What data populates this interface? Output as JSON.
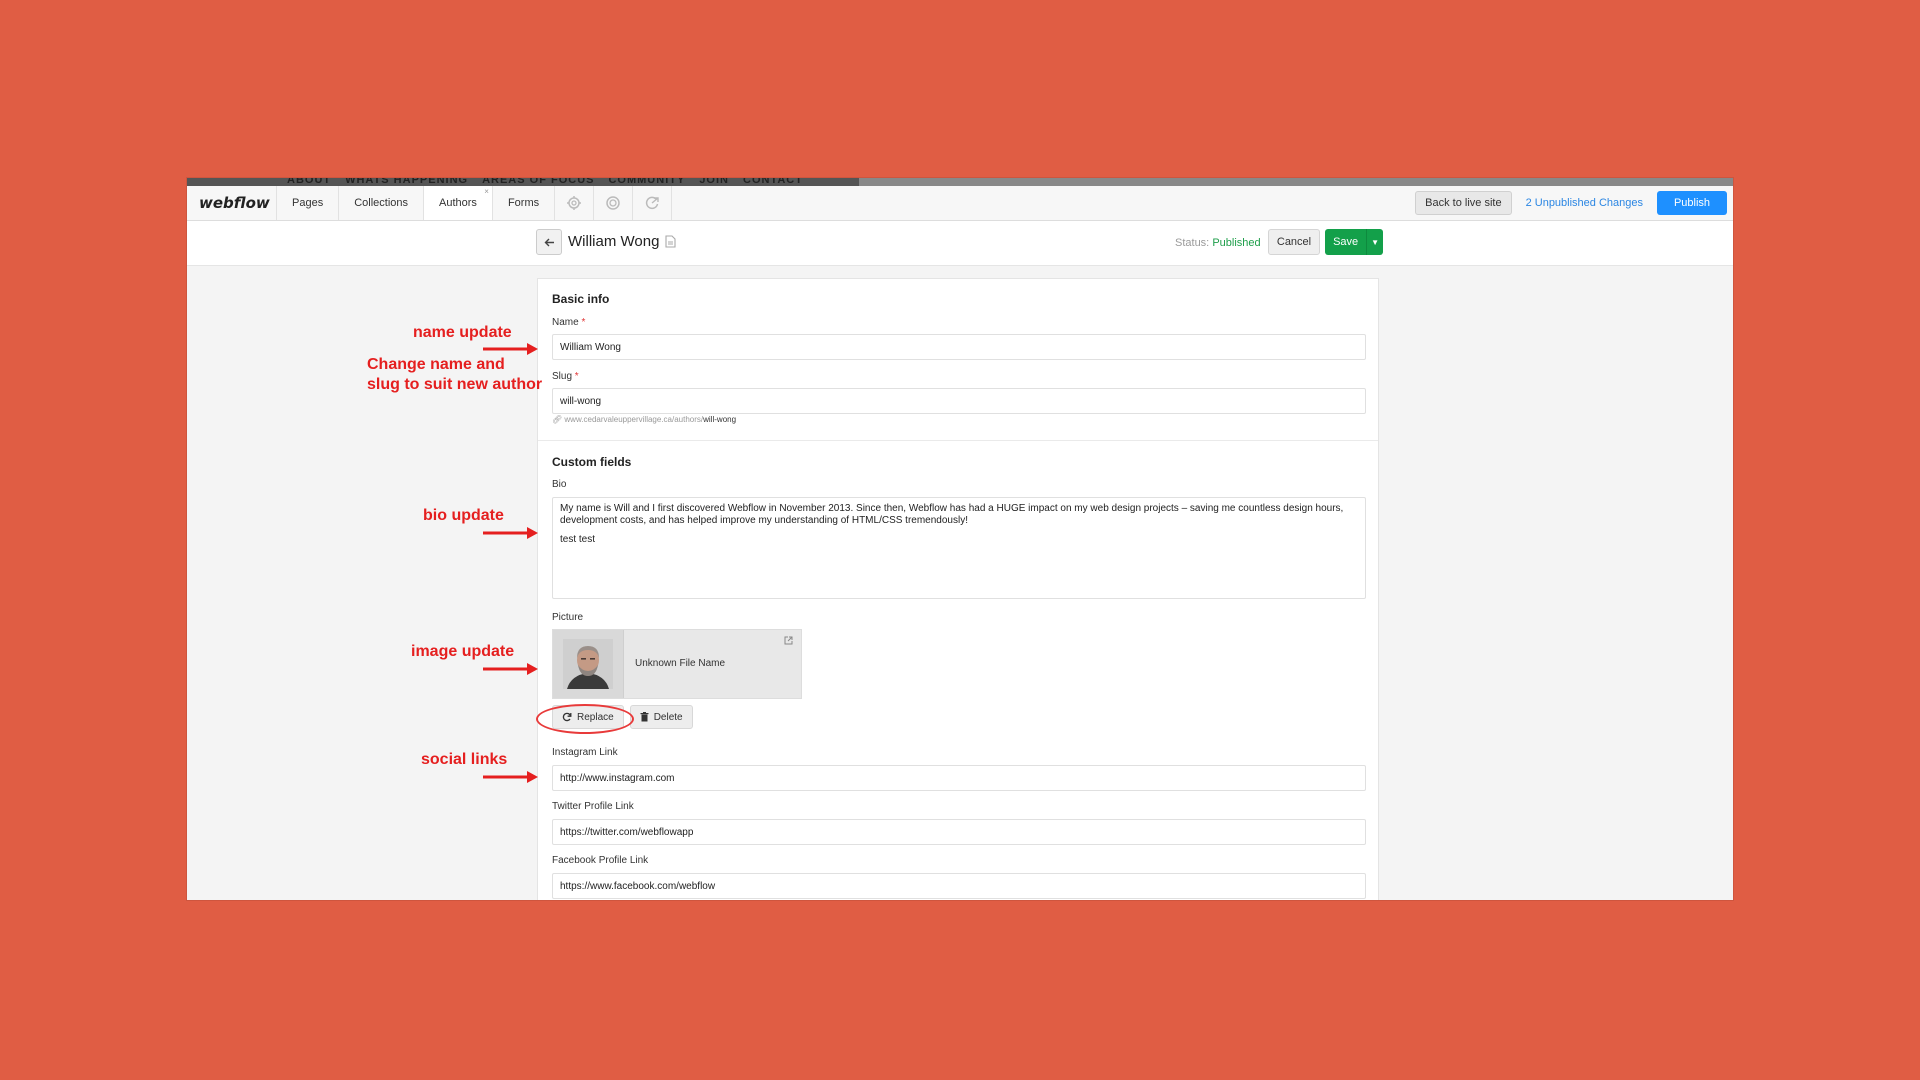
{
  "site_nav": [
    "ABOUT",
    "WHATS HAPPENING",
    "AREAS OF FOCUS",
    "COMMUNITY",
    "JOIN",
    "CONTACT"
  ],
  "topbar": {
    "logo": "webflow",
    "tabs": [
      "Pages",
      "Collections",
      "Authors",
      "Forms"
    ],
    "active_tab_close": "×",
    "icons": [
      "gear-icon",
      "settings-icon",
      "export-icon"
    ],
    "back_to_live": "Back to live site",
    "unpublished": "2 Unpublished Changes",
    "publish": "Publish"
  },
  "header": {
    "title": "William Wong",
    "status_label": "Status:",
    "status_value": "Published",
    "cancel": "Cancel",
    "save": "Save"
  },
  "basic": {
    "title": "Basic info",
    "name_label": "Name",
    "required": "*",
    "name_value": "William Wong",
    "slug_label": "Slug",
    "slug_value": "will-wong",
    "slug_url_base": "www.cedarvaleuppervillage.ca/authors/",
    "slug_url_slug": "will-wong"
  },
  "custom": {
    "title": "Custom fields",
    "bio_label": "Bio",
    "bio_p1": "My name is Will and I first discovered Webflow in November 2013. Since then, Webflow has had a HUGE impact on my web design projects – saving me countless design hours, development costs, and has helped improve my understanding of HTML/CSS tremendously!",
    "bio_p2": "test test",
    "picture_label": "Picture",
    "file_name": "Unknown File Name",
    "replace": "Replace",
    "delete": "Delete",
    "instagram_label": "Instagram Link",
    "instagram_value": "http://www.instagram.com",
    "twitter_label": "Twitter Profile Link",
    "twitter_value": "https://twitter.com/webflowapp",
    "facebook_label": "Facebook Profile Link",
    "facebook_value": "https://www.facebook.com/webflow"
  },
  "annotations": {
    "name_update": "name update",
    "change_line1": "Change name and",
    "change_line2": "slug to suit new author",
    "bio_update": "bio update",
    "image_update": "image update",
    "social_links": "social links"
  },
  "colors": {
    "background": "#E05D44",
    "annotation": "#E51F1F",
    "publish_blue": "#1E90FF",
    "save_green": "#13A04A"
  }
}
